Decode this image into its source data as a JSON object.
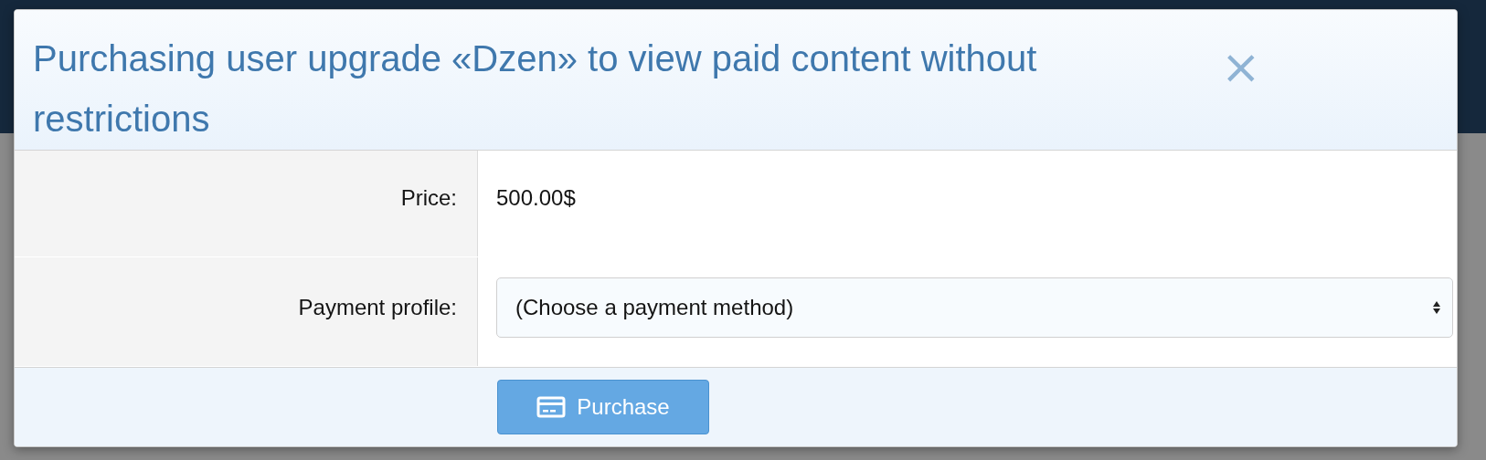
{
  "dialog": {
    "title": "Purchasing user upgrade «Dzen» to view paid content without restrictions",
    "close": "×"
  },
  "rows": [
    {
      "kind": "text",
      "label": "Price:",
      "value": "500.00$"
    },
    {
      "kind": "select",
      "label": "Payment profile:",
      "value": "(Choose a payment method)"
    }
  ],
  "button": {
    "label": "Purchase"
  }
}
